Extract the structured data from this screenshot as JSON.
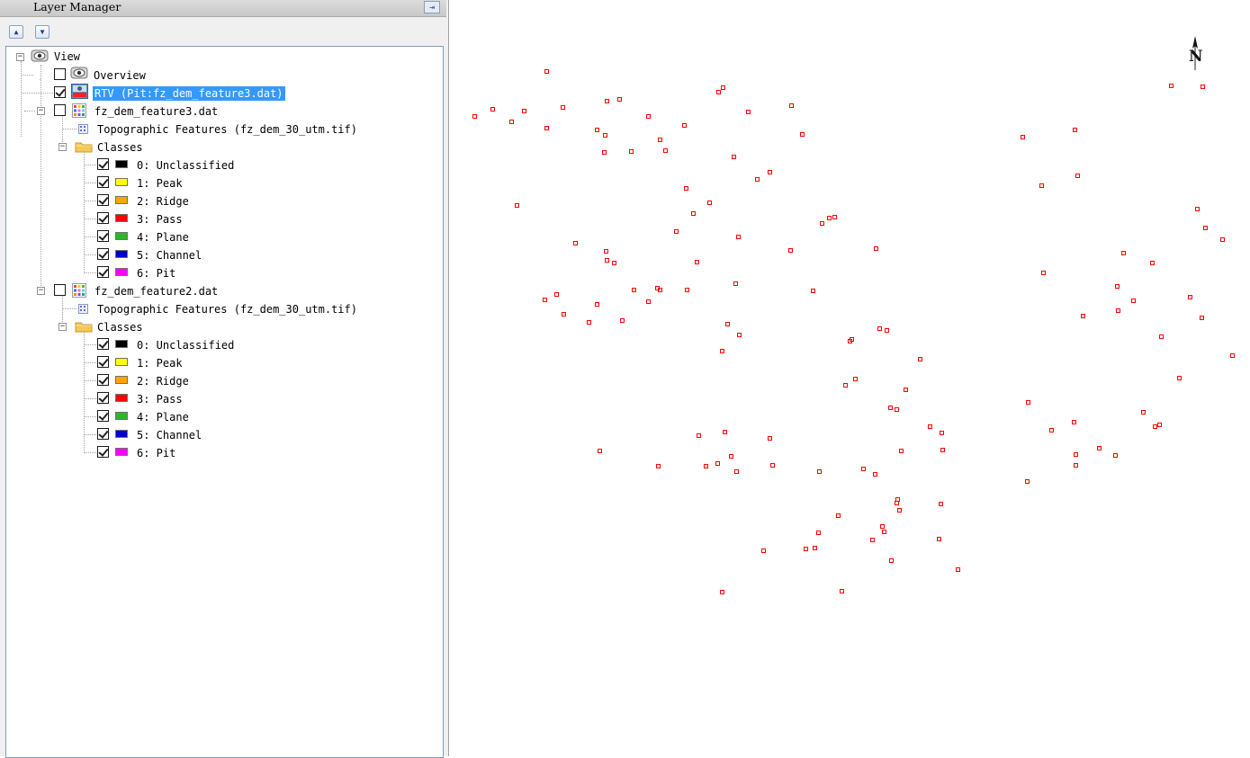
{
  "panel": {
    "title": "Layer Manager"
  },
  "tree": {
    "root": "View",
    "overview": "Overview",
    "rtv": "RTV (Pit:fz_dem_feature3.dat)",
    "datasets": [
      {
        "name": "fz_dem_feature3.dat",
        "source": "Topographic Features (fz_dem_30_utm.tif)",
        "classes_label": "Classes",
        "classes": [
          {
            "label": "0: Unclassified",
            "color": "#000000"
          },
          {
            "label": "1: Peak",
            "color": "#ffff00"
          },
          {
            "label": "2: Ridge",
            "color": "#ffa500"
          },
          {
            "label": "3: Pass",
            "color": "#ff0000"
          },
          {
            "label": "4: Plane",
            "color": "#2db52d"
          },
          {
            "label": "5: Channel",
            "color": "#0000cd"
          },
          {
            "label": "6: Pit",
            "color": "#ff00ff"
          }
        ]
      },
      {
        "name": "fz_dem_feature2.dat",
        "source": "Topographic Features (fz_dem_30_utm.tif)",
        "classes_label": "Classes",
        "classes": [
          {
            "label": "0: Unclassified",
            "color": "#000000"
          },
          {
            "label": "1: Peak",
            "color": "#ffff00"
          },
          {
            "label": "2: Ridge",
            "color": "#ffa500"
          },
          {
            "label": "3: Pass",
            "color": "#ff0000"
          },
          {
            "label": "4: Plane",
            "color": "#2db52d"
          },
          {
            "label": "5: Channel",
            "color": "#0000cd"
          },
          {
            "label": "6: Pit",
            "color": "#ff00ff"
          }
        ]
      }
    ]
  },
  "map": {
    "north_label": "N",
    "point_color": "#ff0000"
  }
}
